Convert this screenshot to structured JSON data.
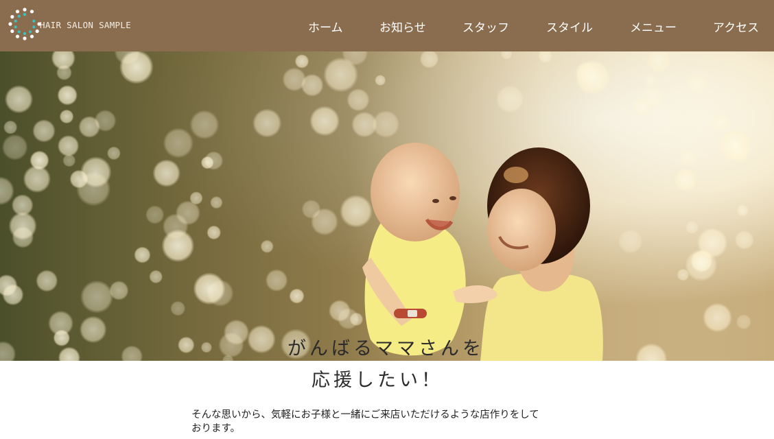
{
  "header": {
    "logo_text": "HAIR SALON SAMPLE",
    "colors": {
      "bar": "#8a6d4e",
      "nav_text": "#ffffff",
      "logo_dot_teal": "#3cc2c2",
      "logo_dot_white": "#ffffff"
    }
  },
  "nav": {
    "items": [
      {
        "label": "ホーム"
      },
      {
        "label": "お知らせ"
      },
      {
        "label": "スタッフ"
      },
      {
        "label": "スタイル"
      },
      {
        "label": "メニュー"
      },
      {
        "label": "アクセス"
      }
    ]
  },
  "hero": {
    "image": "mother-lifting-baby-in-sunlit-trees"
  },
  "catch": {
    "line1": "がんばるママさんを",
    "line2": "応援したい！"
  },
  "intro": {
    "line1": "そんな思いから、気軽にお子様と一緒にご来店いただけるような店作りをして",
    "line2": "おります。"
  }
}
